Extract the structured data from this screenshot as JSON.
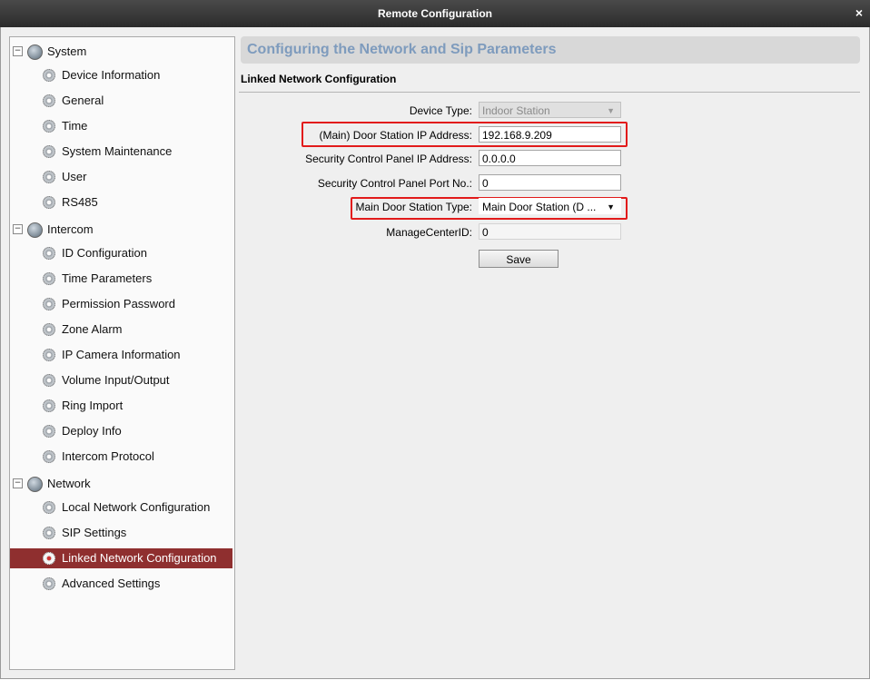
{
  "window": {
    "title": "Remote Configuration",
    "close_glyph": "×"
  },
  "tree": {
    "groups": [
      {
        "label": "System",
        "icon": "globe-icon",
        "expander": "−",
        "items": [
          "Device Information",
          "General",
          "Time",
          "System Maintenance",
          "User",
          "RS485"
        ]
      },
      {
        "label": "Intercom",
        "icon": "globe-icon",
        "expander": "−",
        "items": [
          "ID Configuration",
          "Time Parameters",
          "Permission Password",
          "Zone Alarm",
          "IP Camera Information",
          "Volume Input/Output",
          "Ring Import",
          "Deploy Info",
          "Intercom Protocol"
        ]
      },
      {
        "label": "Network",
        "icon": "globe-icon",
        "expander": "−",
        "items": [
          "Local Network Configuration",
          "SIP Settings",
          "Linked Network Configuration",
          "Advanced Settings"
        ]
      }
    ],
    "selected": "Linked Network Configuration"
  },
  "page": {
    "title": "Configuring the Network and Sip Parameters",
    "section": "Linked Network Configuration"
  },
  "form": {
    "device_type": {
      "label": "Device Type:",
      "value": "Indoor Station"
    },
    "main_door_ip": {
      "label": "(Main) Door Station IP Address:",
      "value": "192.168.9.209"
    },
    "security_ip": {
      "label": "Security Control Panel IP Address:",
      "value": "0.0.0.0"
    },
    "security_port": {
      "label": "Security Control Panel Port No.:",
      "value": "0"
    },
    "main_door_type": {
      "label": "Main Door Station Type:",
      "value": "Main Door Station (D ..."
    },
    "manage_center_id": {
      "label": "ManageCenterID:",
      "value": "0"
    },
    "save_label": "Save",
    "caret_glyph": "▼"
  },
  "colors": {
    "accent_selected": "#8f2f2f",
    "highlight": "#e21b1b",
    "header_title": "#7e9bbd"
  }
}
